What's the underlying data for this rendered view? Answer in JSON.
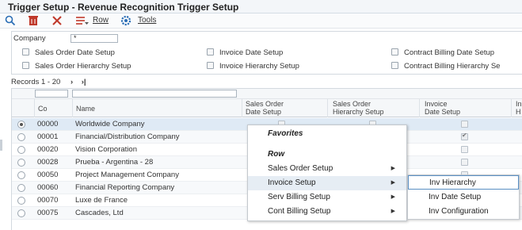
{
  "window": {
    "title": "Trigger Setup - Revenue Recognition Trigger Setup"
  },
  "toolbar": {
    "row_label": "Row",
    "tools_label": "Tools"
  },
  "criteria": {
    "company_label": "Company",
    "company_value": "*",
    "checkboxes": [
      "Sales Order Date Setup",
      "Invoice Date Setup",
      "Contract Billing Date Setup",
      "Sales Order Hierarchy Setup",
      "Invoice Hierarchy Setup",
      "Contract Billing Hierarchy Se"
    ]
  },
  "records": {
    "label": "Records 1 - 20",
    "next": "›",
    "last": "›|"
  },
  "grid": {
    "headers": {
      "co": "Co",
      "name": "Name",
      "so_date": [
        "Sales Order",
        "Date Setup"
      ],
      "so_hier": [
        "Sales Order",
        "Hierarchy Setup"
      ],
      "inv_date": [
        "Invoice",
        "Date Setup"
      ],
      "inv_hier": [
        "In",
        "H"
      ]
    },
    "rows": [
      {
        "co": "00000",
        "name": "Worldwide Company",
        "selected": true,
        "inv_date_checked": false
      },
      {
        "co": "00001",
        "name": "Financial/Distribution Company",
        "selected": false,
        "inv_date_checked": true
      },
      {
        "co": "00020",
        "name": "Vision Corporation",
        "selected": false,
        "inv_date_checked": false
      },
      {
        "co": "00028",
        "name": "Prueba - Argentina - 28",
        "selected": false,
        "inv_date_checked": false
      },
      {
        "co": "00050",
        "name": "Project Management Company",
        "selected": false,
        "inv_date_checked": false
      },
      {
        "co": "00060",
        "name": "Financial Reporting Company",
        "selected": false,
        "inv_date_checked": false
      },
      {
        "co": "00070",
        "name": "Luxe de France",
        "selected": false,
        "inv_date_checked": false
      },
      {
        "co": "00075",
        "name": "Cascades, Ltd",
        "selected": false,
        "inv_date_checked": false
      }
    ]
  },
  "context_menu": {
    "favorites": "Favorites",
    "row": "Row",
    "items": [
      "Sales Order Setup",
      "Invoice Setup",
      "Serv Billing Setup",
      "Cont Billing Setup"
    ]
  },
  "submenu": {
    "items": [
      "Inv Hierarchy",
      "Inv Date Setup",
      "Inv Configuration"
    ]
  },
  "colors": {
    "delete_red": "#c0392b",
    "accent_blue": "#2a6db5",
    "selection": "#dfeaf5"
  }
}
